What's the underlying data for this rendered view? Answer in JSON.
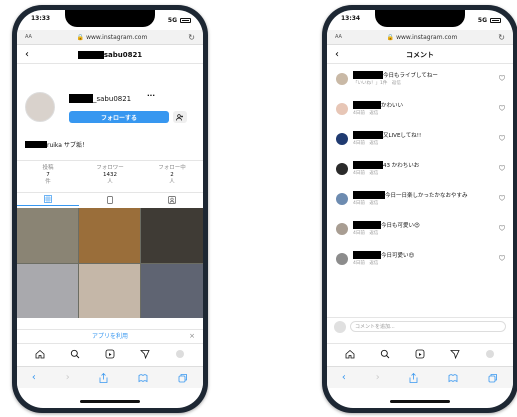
{
  "colors": {
    "accent": "#3797f0",
    "frame": "#1d2733"
  },
  "left_phone": {
    "status": {
      "time": "13:33",
      "signal": "5G"
    },
    "browser": {
      "aa": "AA",
      "url": "www.instagram.com"
    },
    "header": {
      "username_suffix": "sabu0821"
    },
    "profile": {
      "username_suffix": "_sabu0821",
      "more": "···",
      "follow_label": "フォローする",
      "add_person_icon": "add-person-icon"
    },
    "bio": "ruika サブ垢！",
    "stats": [
      {
        "label": "投稿",
        "number": "7",
        "unit": "件"
      },
      {
        "label": "フォロワー",
        "number": "1432",
        "unit": "人"
      },
      {
        "label": "フォロー中",
        "number": "2",
        "unit": "人"
      }
    ],
    "app_banner": {
      "label": "アプリを利用",
      "close": "×"
    }
  },
  "right_phone": {
    "status": {
      "time": "13:34",
      "signal": "5G"
    },
    "browser": {
      "aa": "AA",
      "url": "www.instagram.com"
    },
    "header": {
      "title": "コメント"
    },
    "comments": [
      {
        "text": "今日もライブしてねー",
        "meta": "「いいね！」1件　返信"
      },
      {
        "text": "かわいい",
        "meta": "4日前　返信"
      },
      {
        "text": "又LIVEしてね!!",
        "meta": "4日前　返信"
      },
      {
        "text": "43 かわちいお",
        "meta": "4日前　返信"
      },
      {
        "text": "今日一日楽しかったかなおやすみ",
        "meta": "4日前　返信"
      },
      {
        "text": "今日も可愛い😍",
        "meta": "4日前　返信"
      },
      {
        "text": "今日可愛い😍",
        "meta": "4日前　返信"
      }
    ],
    "comment_placeholder": "コメントを追加..."
  }
}
